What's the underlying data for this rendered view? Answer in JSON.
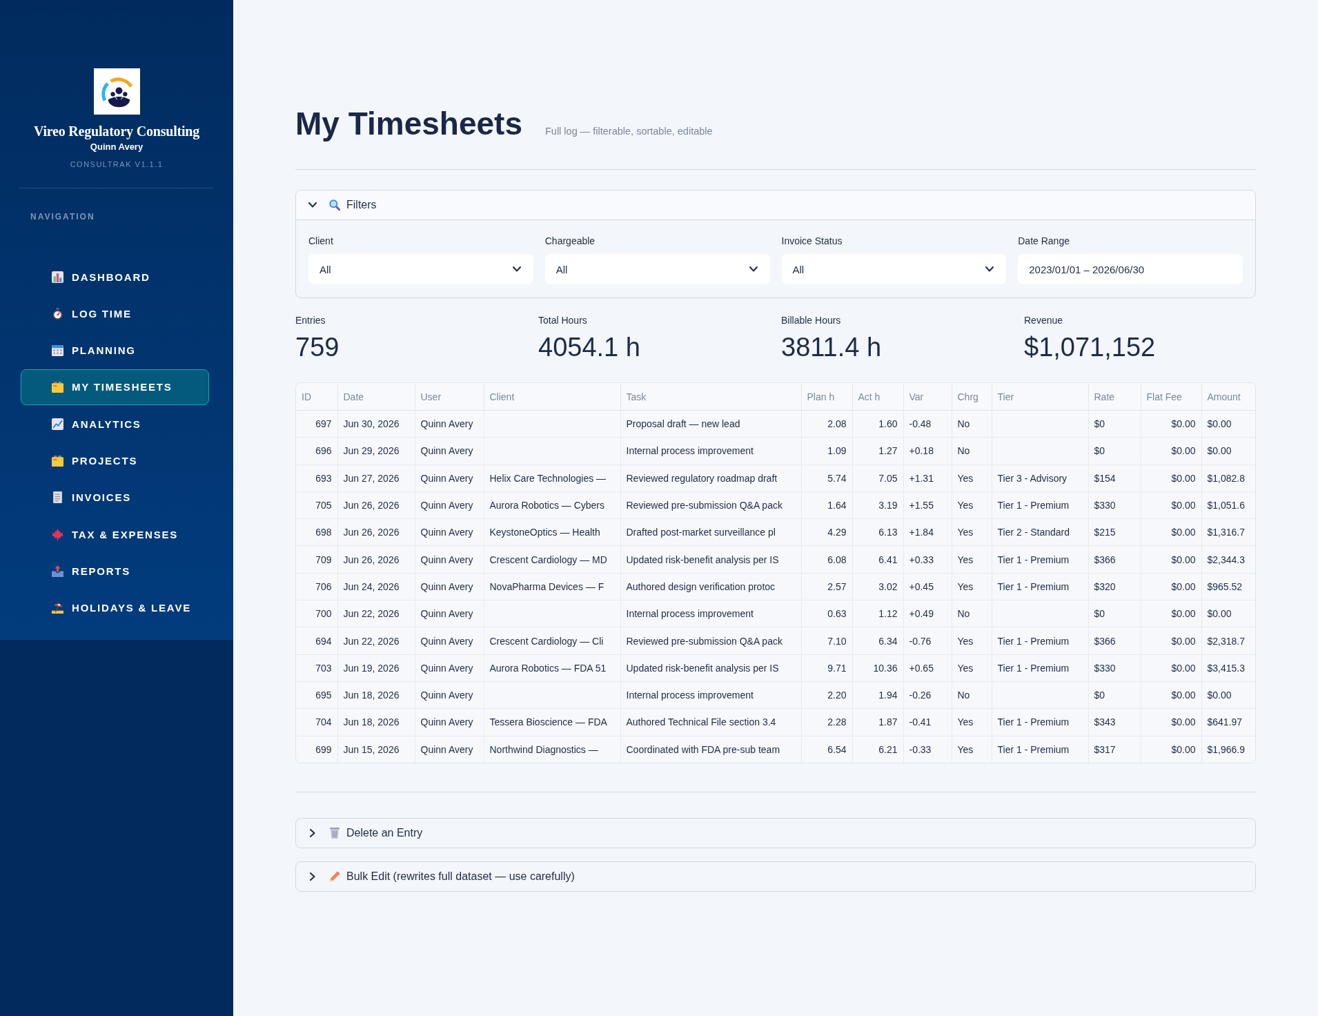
{
  "sidebar": {
    "brand": {
      "name": "Vireo Regulatory Consulting",
      "user": "Quinn Avery",
      "version": "CONSULTRAK V1.1.1"
    },
    "nav": {
      "heading": "NAVIGATION",
      "items": [
        {
          "label": "DASHBOARD",
          "selected": false
        },
        {
          "label": "LOG TIME",
          "selected": false
        },
        {
          "label": "PLANNING",
          "selected": false
        },
        {
          "label": "MY TIMESHEETS",
          "selected": true
        },
        {
          "label": "ANALYTICS",
          "selected": false
        },
        {
          "label": "PROJECTS",
          "selected": false
        },
        {
          "label": "INVOICES",
          "selected": false
        },
        {
          "label": "TAX & EXPENSES",
          "selected": false
        },
        {
          "label": "REPORTS",
          "selected": false
        },
        {
          "label": "HOLIDAYS & LEAVE",
          "selected": false
        }
      ]
    }
  },
  "page": {
    "title": "My Timesheets",
    "subtitle": "Full log — filterable, sortable, editable"
  },
  "filters": {
    "label": "Filters",
    "expanded": true,
    "fields": [
      {
        "kind": "select",
        "label": "Client",
        "value": "All"
      },
      {
        "kind": "select",
        "label": "Chargeable",
        "value": "All"
      },
      {
        "kind": "select",
        "label": "Invoice Status",
        "value": "All"
      },
      {
        "kind": "date",
        "label": "Date Range",
        "value": "2023/01/01 – 2026/06/30"
      }
    ]
  },
  "metrics": [
    {
      "label": "Entries",
      "value": "759"
    },
    {
      "label": "Total Hours",
      "value": "4054.1 h"
    },
    {
      "label": "Billable Hours",
      "value": "3811.4 h"
    },
    {
      "label": "Revenue",
      "value": "$1,071,152"
    }
  ],
  "table": {
    "columns": [
      "ID",
      "Date",
      "User",
      "Client",
      "Task",
      "Plan h",
      "Act h",
      "Var",
      "Chrg",
      "Tier",
      "Rate",
      "Flat Fee",
      "Amount"
    ],
    "rows": [
      [
        "697",
        "Jun 30, 2026",
        "Quinn Avery",
        null,
        "Proposal draft — new lead",
        "2.08",
        "1.60",
        "-0.48",
        "No",
        null,
        "$0",
        "$0.00",
        "$0.00"
      ],
      [
        "696",
        "Jun 29, 2026",
        "Quinn Avery",
        null,
        "Internal process improvement",
        "1.09",
        "1.27",
        "+0.18",
        "No",
        null,
        "$0",
        "$0.00",
        "$0.00"
      ],
      [
        "693",
        "Jun 27, 2026",
        "Quinn Avery",
        "Helix Care Technologies —",
        "Reviewed regulatory roadmap draft",
        "5.74",
        "7.05",
        "+1.31",
        "Yes",
        "Tier 3 - Advisory",
        "$154",
        "$0.00",
        "$1,082.8"
      ],
      [
        "705",
        "Jun 26, 2026",
        "Quinn Avery",
        "Aurora Robotics — Cybers",
        "Reviewed pre-submission Q&A pack",
        "1.64",
        "3.19",
        "+1.55",
        "Yes",
        "Tier 1 - Premium",
        "$330",
        "$0.00",
        "$1,051.6"
      ],
      [
        "698",
        "Jun 26, 2026",
        "Quinn Avery",
        "KeystoneOptics — Health",
        "Drafted post-market surveillance pl",
        "4.29",
        "6.13",
        "+1.84",
        "Yes",
        "Tier 2 - Standard",
        "$215",
        "$0.00",
        "$1,316.7"
      ],
      [
        "709",
        "Jun 26, 2026",
        "Quinn Avery",
        "Crescent Cardiology — MD",
        "Updated risk-benefit analysis per IS",
        "6.08",
        "6.41",
        "+0.33",
        "Yes",
        "Tier 1 - Premium",
        "$366",
        "$0.00",
        "$2,344.3"
      ],
      [
        "706",
        "Jun 24, 2026",
        "Quinn Avery",
        "NovaPharma Devices — F",
        "Authored design verification protoc",
        "2.57",
        "3.02",
        "+0.45",
        "Yes",
        "Tier 1 - Premium",
        "$320",
        "$0.00",
        "$965.52"
      ],
      [
        "700",
        "Jun 22, 2026",
        "Quinn Avery",
        null,
        "Internal process improvement",
        "0.63",
        "1.12",
        "+0.49",
        "No",
        null,
        "$0",
        "$0.00",
        "$0.00"
      ],
      [
        "694",
        "Jun 22, 2026",
        "Quinn Avery",
        "Crescent Cardiology — Cli",
        "Reviewed pre-submission Q&A pack",
        "7.10",
        "6.34",
        "-0.76",
        "Yes",
        "Tier 1 - Premium",
        "$366",
        "$0.00",
        "$2,318.7"
      ],
      [
        "703",
        "Jun 19, 2026",
        "Quinn Avery",
        "Aurora Robotics — FDA 51",
        "Updated risk-benefit analysis per IS",
        "9.71",
        "10.36",
        "+0.65",
        "Yes",
        "Tier 1 - Premium",
        "$330",
        "$0.00",
        "$3,415.3"
      ],
      [
        "695",
        "Jun 18, 2026",
        "Quinn Avery",
        null,
        "Internal process improvement",
        "2.20",
        "1.94",
        "-0.26",
        "No",
        null,
        "$0",
        "$0.00",
        "$0.00"
      ],
      [
        "704",
        "Jun 18, 2026",
        "Quinn Avery",
        "Tessera Bioscience — FDA",
        "Authored Technical File section 3.4",
        "2.28",
        "1.87",
        "-0.41",
        "Yes",
        "Tier 1 - Premium",
        "$343",
        "$0.00",
        "$641.97"
      ],
      [
        "699",
        "Jun 15, 2026",
        "Quinn Avery",
        "Northwind Diagnostics —",
        "Coordinated with FDA pre-sub team",
        "6.54",
        "6.21",
        "-0.33",
        "Yes",
        "Tier 1 - Premium",
        "$317",
        "$0.00",
        "$1,966.9"
      ]
    ]
  },
  "sections": [
    {
      "label": "Delete an Entry",
      "expanded": false
    },
    {
      "label": "Bulk Edit (rewrites full dataset — use carefully)",
      "expanded": false
    }
  ]
}
